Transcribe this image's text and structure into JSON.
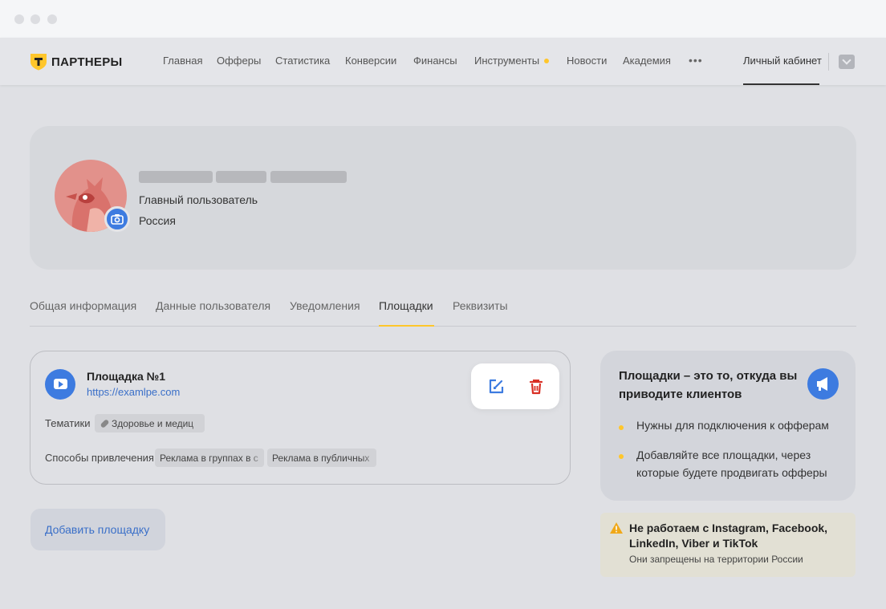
{
  "brand": {
    "logo_text": "ПАРТНЕРЫ",
    "logo_letter": "T",
    "accent": "#ffc62b",
    "primary": "#3d7be0"
  },
  "nav": {
    "items": [
      "Главная",
      "Офферы",
      "Статистика",
      "Конверсии",
      "Финансы",
      "Инструменты",
      "Новости",
      "Академия"
    ],
    "more_label": "•••",
    "cabinet_label": "Личный кабинет"
  },
  "profile": {
    "role": "Главный пользователь",
    "country": "Россия"
  },
  "tabs": [
    {
      "label": "Общая информация",
      "active": false
    },
    {
      "label": "Данные пользователя",
      "active": false
    },
    {
      "label": "Уведомления",
      "active": false
    },
    {
      "label": "Площадки",
      "active": true
    },
    {
      "label": "Реквизиты",
      "active": false
    }
  ],
  "platform": {
    "name": "Площадка №1",
    "url": "https://examlpe.com",
    "topics_label": "Тематики",
    "topics": [
      "Здоровье и медиц"
    ],
    "methods_label": "Способы привлечения",
    "methods": [
      "Реклама в группах в с",
      "Реклама в публичных"
    ]
  },
  "add_button_label": "Добавить площадку",
  "info": {
    "title": "Площадки – это то, откуда вы приводите клиентов",
    "bullets": [
      "Нужны для подключения к офферам",
      "Добавляйте все площадки, через которые будете продвигать офферы"
    ]
  },
  "warning": {
    "title": "Не работаем с Instagram, Facebook, LinkedIn, Viber и TikTok",
    "subtitle": "Они запрещены на территории России"
  }
}
